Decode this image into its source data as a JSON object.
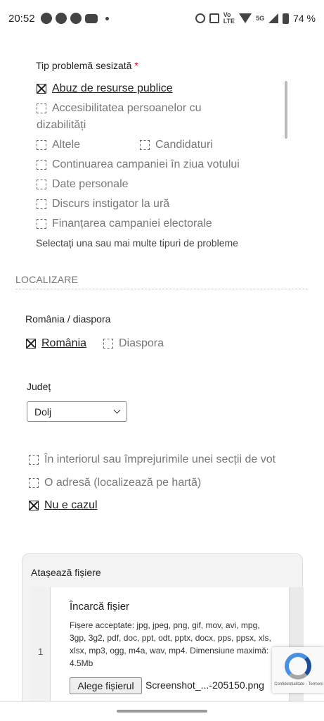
{
  "status_bar": {
    "time": "20:52",
    "battery": "74 %",
    "network_labels": [
      "Vo",
      "LTE",
      "5G"
    ]
  },
  "issue_type": {
    "label": "Tip problemă sesizată",
    "required_mark": "*",
    "options": [
      {
        "label": "Abuz de resurse publice",
        "checked": true
      },
      {
        "label": "Accesibilitatea persoanelor cu",
        "label_cont": "dizabilități",
        "checked": false
      },
      {
        "label": "Altele",
        "checked": false
      },
      {
        "label": "Candidaturi",
        "checked": false
      },
      {
        "label": "Continuarea campaniei în ziua votului",
        "checked": false
      },
      {
        "label": "Date personale",
        "checked": false
      },
      {
        "label": "Discurs instigator la ură",
        "checked": false
      },
      {
        "label": "Finanțarea campaniei electorale",
        "checked": false
      }
    ],
    "helper": "Selectați una sau mai multe tipuri de probleme"
  },
  "location": {
    "header": "LOCALIZARE",
    "region_label": "România / diaspora",
    "region_options": [
      {
        "label": "România",
        "checked": true
      },
      {
        "label": "Diaspora",
        "checked": false
      }
    ],
    "county_label": "Județ",
    "county_value": "Dolj",
    "place_options": [
      {
        "label": "În interiorul sau împrejurimile unei secții de vot",
        "checked": false
      },
      {
        "label": "O adresă (localizează pe hartă)",
        "checked": false
      },
      {
        "label": "Nu e cazul",
        "checked": true
      }
    ]
  },
  "attachments": {
    "title": "Atașează fișiere",
    "row_number": "1",
    "upload_title": "Încarcă fișier",
    "upload_desc": "Fișere acceptate: jpg, jpeg, png, gif, mov, avi, mpg, 3gp, 3g2, pdf, doc, ppt, odt, pptx, docx, pps, ppsx, xls, xlsx, mp3, ogg, m4a, wav, mp4. Dimensiune maximă: 4.5Mb",
    "choose_button": "Alege fișierul",
    "file_name": "Screenshot_...-205150.png"
  },
  "recaptcha": {
    "terms": "Confidențialitate - Termeni"
  }
}
